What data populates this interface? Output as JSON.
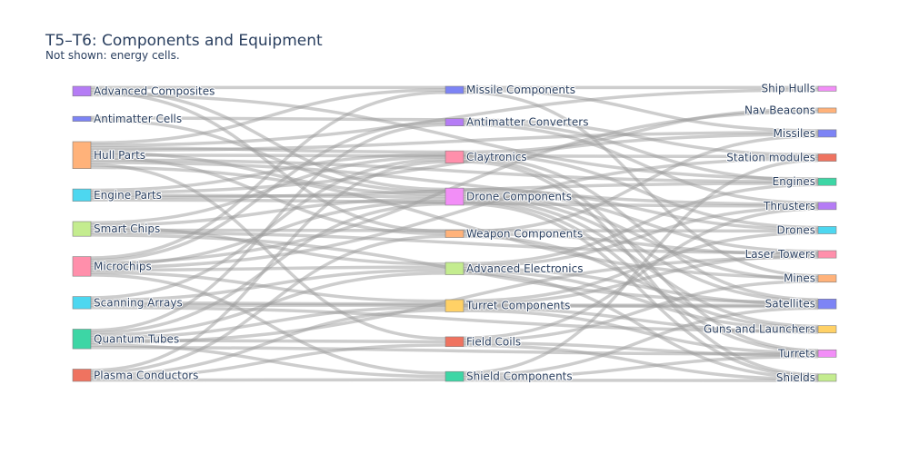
{
  "chart_data": {
    "type": "sankey",
    "title": "T5–T6: Components and Equipment",
    "subtitle": "Not shown: energy cells.",
    "columns": [
      [
        {
          "id": "advanced_composites",
          "label": "Advanced Composites",
          "color": "#b57cf5",
          "value": 4
        },
        {
          "id": "antimatter_cells",
          "label": "Antimatter Cells",
          "color": "#7d84f5",
          "value": 2
        },
        {
          "id": "hull_parts",
          "label": "Hull Parts",
          "color": "#ffb27a",
          "value": 11
        },
        {
          "id": "engine_parts",
          "label": "Engine Parts",
          "color": "#4dd7f0",
          "value": 5
        },
        {
          "id": "smart_chips",
          "label": "Smart Chips",
          "color": "#c4ec8f",
          "value": 6
        },
        {
          "id": "microchips",
          "label": "Microchips",
          "color": "#ff8fab",
          "value": 8
        },
        {
          "id": "scanning_arrays",
          "label": "Scanning Arrays",
          "color": "#4dd7f0",
          "value": 5
        },
        {
          "id": "quantum_tubes",
          "label": "Quantum Tubes",
          "color": "#3dd6a5",
          "value": 8
        },
        {
          "id": "plasma_conductors",
          "label": "Plasma Conductors",
          "color": "#ef7360",
          "value": 5
        }
      ],
      [
        {
          "id": "missile_components",
          "label": "Missile Components",
          "color": "#7d84f5",
          "value": 3
        },
        {
          "id": "antimatter_converters",
          "label": "Antimatter Converters",
          "color": "#b57cf5",
          "value": 3
        },
        {
          "id": "claytronics",
          "label": "Claytronics",
          "color": "#ff8fab",
          "value": 5
        },
        {
          "id": "drone_components",
          "label": "Drone Components",
          "color": "#f28ef7",
          "value": 7
        },
        {
          "id": "weapon_components",
          "label": "Weapon Components",
          "color": "#ffb27a",
          "value": 3
        },
        {
          "id": "advanced_electronics",
          "label": "Advanced Electronics",
          "color": "#c4ec8f",
          "value": 5
        },
        {
          "id": "turret_components",
          "label": "Turret Components",
          "color": "#ffd166",
          "value": 5
        },
        {
          "id": "field_coils",
          "label": "Field Coils",
          "color": "#ef7360",
          "value": 4
        },
        {
          "id": "shield_components",
          "label": "Shield Components",
          "color": "#3dd6a5",
          "value": 4
        }
      ],
      [
        {
          "id": "ship_hulls",
          "label": "Ship Hulls",
          "color": "#f28ef7",
          "value": 2
        },
        {
          "id": "nav_beacons",
          "label": "Nav Beacons",
          "color": "#ffb27a",
          "value": 2
        },
        {
          "id": "missiles",
          "label": "Missiles",
          "color": "#7d84f5",
          "value": 3
        },
        {
          "id": "station_modules",
          "label": "Station modules",
          "color": "#ef7360",
          "value": 3
        },
        {
          "id": "engines",
          "label": "Engines",
          "color": "#3dd6a5",
          "value": 3
        },
        {
          "id": "thrusters",
          "label": "Thrusters",
          "color": "#b57cf5",
          "value": 3
        },
        {
          "id": "drones",
          "label": "Drones",
          "color": "#4dd7f0",
          "value": 3
        },
        {
          "id": "laser_towers",
          "label": "Laser Towers",
          "color": "#ff8fab",
          "value": 3
        },
        {
          "id": "mines",
          "label": "Mines",
          "color": "#ffb27a",
          "value": 3
        },
        {
          "id": "satellites",
          "label": "Satellites",
          "color": "#7d84f5",
          "value": 4
        },
        {
          "id": "guns_and_launchers",
          "label": "Guns and Launchers",
          "color": "#ffd166",
          "value": 3
        },
        {
          "id": "turrets",
          "label": "Turrets",
          "color": "#f28ef7",
          "value": 3
        },
        {
          "id": "shields",
          "label": "Shields",
          "color": "#c4ec8f",
          "value": 3
        }
      ]
    ],
    "links": [
      {
        "source": "advanced_composites",
        "target": "missile_components",
        "value": 1
      },
      {
        "source": "advanced_composites",
        "target": "drone_components",
        "value": 1
      },
      {
        "source": "advanced_composites",
        "target": "weapon_components",
        "value": 1
      },
      {
        "source": "advanced_composites",
        "target": "engines",
        "value": 1
      },
      {
        "source": "antimatter_cells",
        "target": "antimatter_converters",
        "value": 1
      },
      {
        "source": "antimatter_cells",
        "target": "drone_components",
        "value": 1
      },
      {
        "source": "hull_parts",
        "target": "missile_components",
        "value": 1
      },
      {
        "source": "hull_parts",
        "target": "claytronics",
        "value": 1
      },
      {
        "source": "hull_parts",
        "target": "drone_components",
        "value": 1
      },
      {
        "source": "hull_parts",
        "target": "weapon_components",
        "value": 1
      },
      {
        "source": "hull_parts",
        "target": "field_coils",
        "value": 1
      },
      {
        "source": "hull_parts",
        "target": "ship_hulls",
        "value": 1
      },
      {
        "source": "hull_parts",
        "target": "missiles",
        "value": 1
      },
      {
        "source": "hull_parts",
        "target": "station_modules",
        "value": 1
      },
      {
        "source": "hull_parts",
        "target": "engines",
        "value": 1
      },
      {
        "source": "hull_parts",
        "target": "thrusters",
        "value": 1
      },
      {
        "source": "hull_parts",
        "target": "mines",
        "value": 1
      },
      {
        "source": "engine_parts",
        "target": "claytronics",
        "value": 1
      },
      {
        "source": "engine_parts",
        "target": "drone_components",
        "value": 1
      },
      {
        "source": "engine_parts",
        "target": "missiles",
        "value": 1
      },
      {
        "source": "engine_parts",
        "target": "engines",
        "value": 1
      },
      {
        "source": "engine_parts",
        "target": "thrusters",
        "value": 1
      },
      {
        "source": "smart_chips",
        "target": "claytronics",
        "value": 1
      },
      {
        "source": "smart_chips",
        "target": "drone_components",
        "value": 1
      },
      {
        "source": "smart_chips",
        "target": "advanced_electronics",
        "value": 1
      },
      {
        "source": "smart_chips",
        "target": "drones",
        "value": 1
      },
      {
        "source": "smart_chips",
        "target": "laser_towers",
        "value": 1
      },
      {
        "source": "smart_chips",
        "target": "satellites",
        "value": 1
      },
      {
        "source": "microchips",
        "target": "missile_components",
        "value": 1
      },
      {
        "source": "microchips",
        "target": "antimatter_converters",
        "value": 1
      },
      {
        "source": "microchips",
        "target": "drone_components",
        "value": 1
      },
      {
        "source": "microchips",
        "target": "advanced_electronics",
        "value": 1
      },
      {
        "source": "microchips",
        "target": "turret_components",
        "value": 1
      },
      {
        "source": "microchips",
        "target": "shield_components",
        "value": 1
      },
      {
        "source": "microchips",
        "target": "nav_beacons",
        "value": 1
      },
      {
        "source": "microchips",
        "target": "station_modules",
        "value": 1
      },
      {
        "source": "scanning_arrays",
        "target": "claytronics",
        "value": 1
      },
      {
        "source": "scanning_arrays",
        "target": "advanced_electronics",
        "value": 1
      },
      {
        "source": "scanning_arrays",
        "target": "turret_components",
        "value": 1
      },
      {
        "source": "scanning_arrays",
        "target": "satellites",
        "value": 1
      },
      {
        "source": "scanning_arrays",
        "target": "guns_and_launchers",
        "value": 1
      },
      {
        "source": "quantum_tubes",
        "target": "antimatter_converters",
        "value": 1
      },
      {
        "source": "quantum_tubes",
        "target": "drone_components",
        "value": 1
      },
      {
        "source": "quantum_tubes",
        "target": "advanced_electronics",
        "value": 1
      },
      {
        "source": "quantum_tubes",
        "target": "turret_components",
        "value": 1
      },
      {
        "source": "quantum_tubes",
        "target": "field_coils",
        "value": 1
      },
      {
        "source": "quantum_tubes",
        "target": "shield_components",
        "value": 1
      },
      {
        "source": "quantum_tubes",
        "target": "laser_towers",
        "value": 1
      },
      {
        "source": "quantum_tubes",
        "target": "turrets",
        "value": 1
      },
      {
        "source": "plasma_conductors",
        "target": "claytronics",
        "value": 1
      },
      {
        "source": "plasma_conductors",
        "target": "weapon_components",
        "value": 1
      },
      {
        "source": "plasma_conductors",
        "target": "turret_components",
        "value": 1
      },
      {
        "source": "plasma_conductors",
        "target": "field_coils",
        "value": 1
      },
      {
        "source": "plasma_conductors",
        "target": "shield_components",
        "value": 1
      },
      {
        "source": "missile_components",
        "target": "ship_hulls",
        "value": 1
      },
      {
        "source": "missile_components",
        "target": "missiles",
        "value": 1
      },
      {
        "source": "missile_components",
        "target": "mines",
        "value": 1
      },
      {
        "source": "antimatter_converters",
        "target": "engines",
        "value": 1
      },
      {
        "source": "antimatter_converters",
        "target": "thrusters",
        "value": 1
      },
      {
        "source": "antimatter_converters",
        "target": "station_modules",
        "value": 1
      },
      {
        "source": "claytronics",
        "target": "nav_beacons",
        "value": 1
      },
      {
        "source": "claytronics",
        "target": "drones",
        "value": 1
      },
      {
        "source": "claytronics",
        "target": "satellites",
        "value": 1
      },
      {
        "source": "claytronics",
        "target": "turrets",
        "value": 1
      },
      {
        "source": "claytronics",
        "target": "shields",
        "value": 1
      },
      {
        "source": "drone_components",
        "target": "drones",
        "value": 1
      },
      {
        "source": "drone_components",
        "target": "laser_towers",
        "value": 1
      },
      {
        "source": "drone_components",
        "target": "mines",
        "value": 1
      },
      {
        "source": "drone_components",
        "target": "satellites",
        "value": 1
      },
      {
        "source": "drone_components",
        "target": "guns_and_launchers",
        "value": 1
      },
      {
        "source": "drone_components",
        "target": "turrets",
        "value": 1
      },
      {
        "source": "drone_components",
        "target": "shields",
        "value": 1
      },
      {
        "source": "weapon_components",
        "target": "missiles",
        "value": 1
      },
      {
        "source": "weapon_components",
        "target": "laser_towers",
        "value": 1
      },
      {
        "source": "weapon_components",
        "target": "guns_and_launchers",
        "value": 1
      },
      {
        "source": "advanced_electronics",
        "target": "engines",
        "value": 1
      },
      {
        "source": "advanced_electronics",
        "target": "thrusters",
        "value": 1
      },
      {
        "source": "advanced_electronics",
        "target": "satellites",
        "value": 1
      },
      {
        "source": "advanced_electronics",
        "target": "guns_and_launchers",
        "value": 1
      },
      {
        "source": "advanced_electronics",
        "target": "shields",
        "value": 1
      },
      {
        "source": "turret_components",
        "target": "drones",
        "value": 1
      },
      {
        "source": "turret_components",
        "target": "laser_towers",
        "value": 1
      },
      {
        "source": "turret_components",
        "target": "guns_and_launchers",
        "value": 1
      },
      {
        "source": "turret_components",
        "target": "turrets",
        "value": 1
      },
      {
        "source": "turret_components",
        "target": "satellites",
        "value": 1
      },
      {
        "source": "field_coils",
        "target": "mines",
        "value": 1
      },
      {
        "source": "field_coils",
        "target": "turrets",
        "value": 1
      },
      {
        "source": "field_coils",
        "target": "shields",
        "value": 1
      },
      {
        "source": "field_coils",
        "target": "thrusters",
        "value": 1
      },
      {
        "source": "shield_components",
        "target": "shields",
        "value": 1
      },
      {
        "source": "shield_components",
        "target": "satellites",
        "value": 1
      },
      {
        "source": "shield_components",
        "target": "station_modules",
        "value": 1
      },
      {
        "source": "shield_components",
        "target": "turrets",
        "value": 1
      }
    ]
  }
}
